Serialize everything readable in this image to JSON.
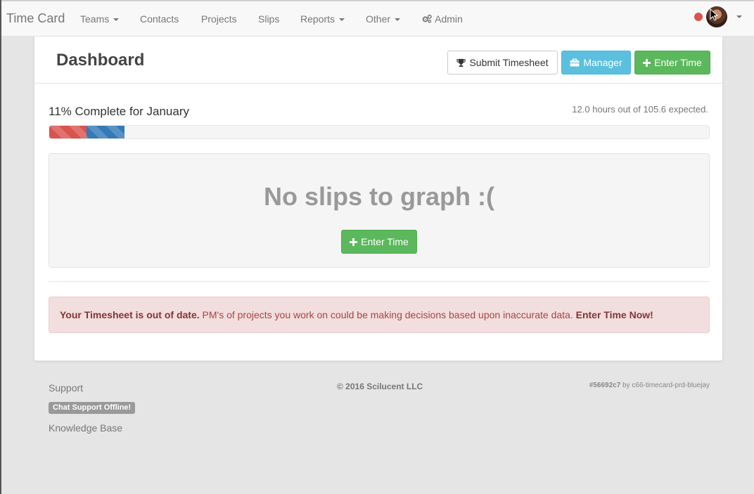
{
  "navbar": {
    "brand": "Time Card",
    "items": [
      {
        "label": "Teams",
        "dropdown": true
      },
      {
        "label": "Contacts",
        "dropdown": false
      },
      {
        "label": "Projects",
        "dropdown": false
      },
      {
        "label": "Slips",
        "dropdown": false
      },
      {
        "label": "Reports",
        "dropdown": true
      },
      {
        "label": "Other",
        "dropdown": true
      },
      {
        "label": "Admin",
        "icon": "gears-icon"
      }
    ],
    "status_color": "#d9534f"
  },
  "header": {
    "title": "Dashboard",
    "buttons": {
      "submit_timesheet": {
        "label": "Submit Timesheet",
        "icon": "trophy-icon"
      },
      "manager": {
        "label": "Manager",
        "icon": "briefcase-icon"
      },
      "enter_time": {
        "label": "Enter Time",
        "icon": "plus-icon"
      }
    }
  },
  "progress": {
    "title": "11% Complete for January",
    "note": "12.0 hours out of 105.6 expected.",
    "segments": [
      {
        "color": "#d9534f",
        "fraction": 0.056
      },
      {
        "color": "#337ab7",
        "fraction": 0.058
      }
    ]
  },
  "graph": {
    "empty_message": "No slips to graph :(",
    "enter_time_label": "Enter Time"
  },
  "alert": {
    "strong": "Your Timesheet is out of date.",
    "text": " PM's of projects you work on could be making decisions based upon inaccurate data. ",
    "link": "Enter Time Now!"
  },
  "footer": {
    "support": "Support",
    "chat_badge": "Chat Support Offline!",
    "knowledge_base": "Knowledge Base",
    "copyright": "© 2016 Scilucent LLC",
    "build_hash": "#56692c7",
    "build_by": " by c66-timecard-prd-bluejay"
  },
  "colors": {
    "primary": "#337ab7",
    "success": "#5cb85c",
    "info": "#5bc0de",
    "danger": "#d9534f"
  }
}
